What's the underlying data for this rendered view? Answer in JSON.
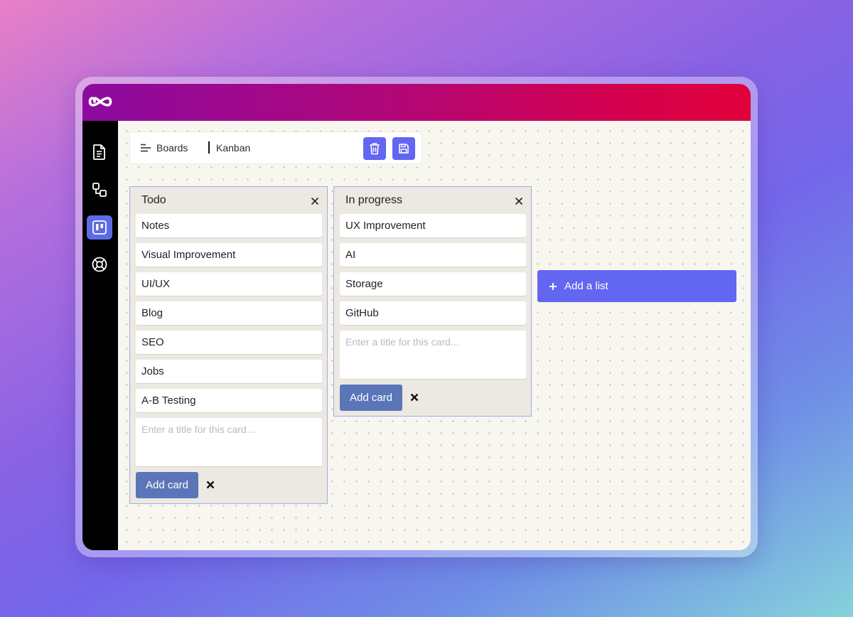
{
  "app": {
    "logo_icon": "infinity-icon",
    "topbar_gradient": [
      "#8c0aa0",
      "#e0003a"
    ]
  },
  "sidebar": {
    "items": [
      {
        "icon": "document-icon",
        "active": false
      },
      {
        "icon": "flow-icon",
        "active": false
      },
      {
        "icon": "kanban-icon",
        "active": true
      },
      {
        "icon": "lifebuoy-icon",
        "active": false
      }
    ],
    "active_color": "#5b6ce8"
  },
  "toolbar": {
    "menu_icon": "menu-lines-icon",
    "breadcrumb": [
      "Boards",
      "Kanban"
    ],
    "delete_icon": "trash-icon",
    "save_icon": "save-icon",
    "button_color": "#6366f1"
  },
  "lists": [
    {
      "title": "Todo",
      "cards": [
        "Notes",
        "Visual Improvement",
        "UI/UX",
        "Blog",
        "SEO",
        "Jobs",
        "A-B Testing"
      ],
      "input_placeholder": "Enter a title for this card...",
      "add_label": "Add card"
    },
    {
      "title": "In progress",
      "cards": [
        "UX Improvement",
        "AI",
        "Storage",
        "GitHub"
      ],
      "input_placeholder": "Enter a title for this card...",
      "add_label": "Add card"
    }
  ],
  "add_list": {
    "label": "Add a list",
    "icon": "plus-icon",
    "color": "#6366f1"
  }
}
